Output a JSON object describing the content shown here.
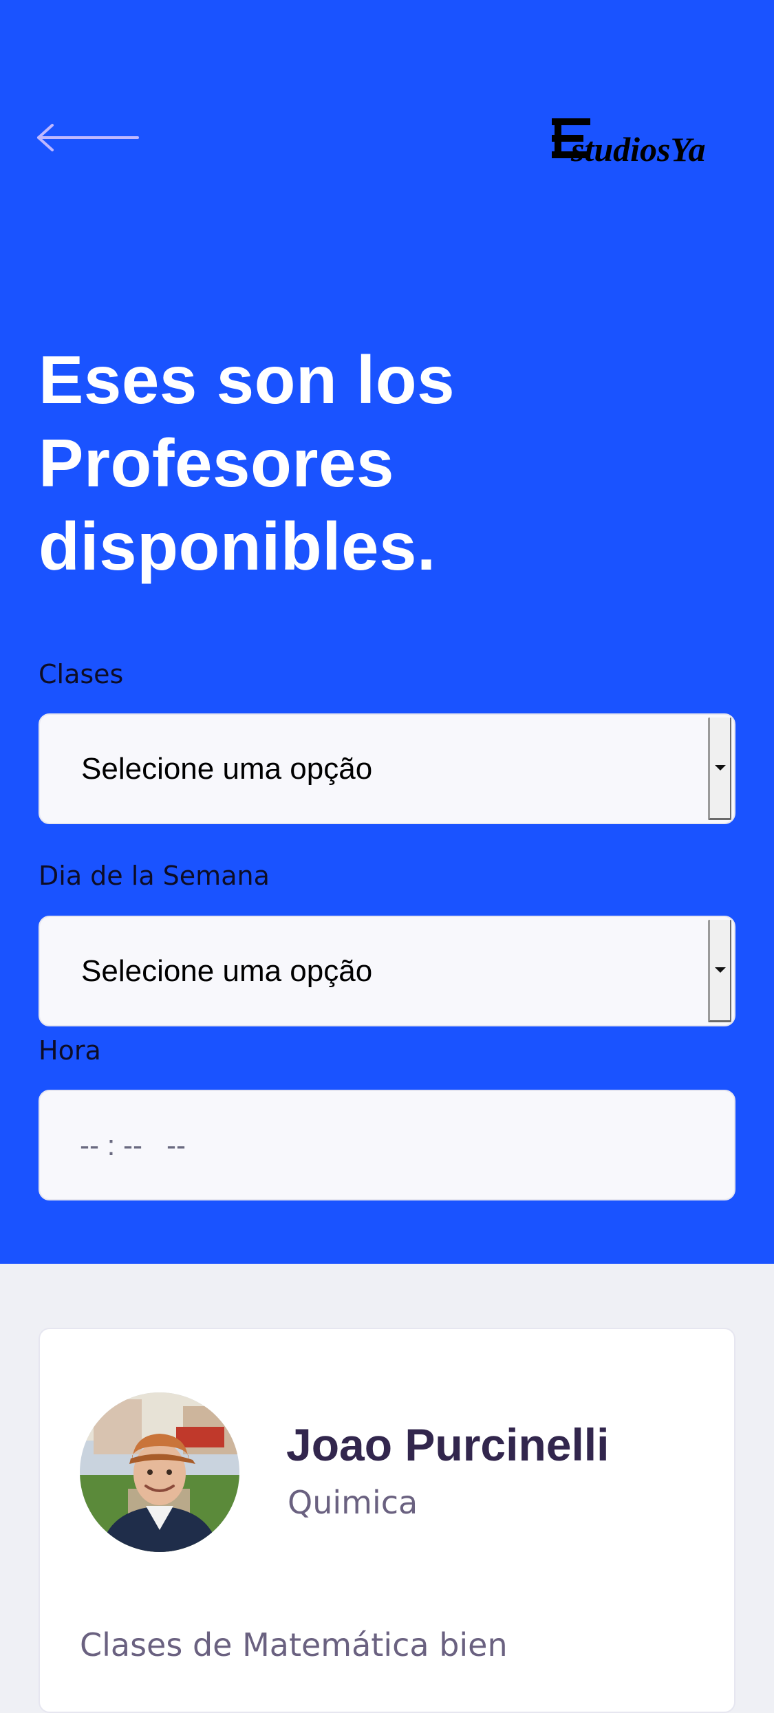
{
  "header": {
    "logo_text": "EstudiosYa",
    "title_lines": [
      "Eses son los",
      "Profesores",
      "disponibles."
    ],
    "accent_color": "#1a53ff"
  },
  "filters": {
    "clases": {
      "label": "Clases",
      "value": "Selecione uma opção"
    },
    "dia": {
      "label": "Dia de la Semana",
      "value": "Selecione uma opção"
    },
    "hora": {
      "label": "Hora",
      "value": "-- : --   --"
    }
  },
  "teacher_card": {
    "name": "Joao Purcinelli",
    "subject": "Quimica",
    "bio": "Clases de Matemática bien"
  },
  "icons": {
    "back": "arrow-left-icon",
    "select_arrow": "chevron-down-icon"
  }
}
